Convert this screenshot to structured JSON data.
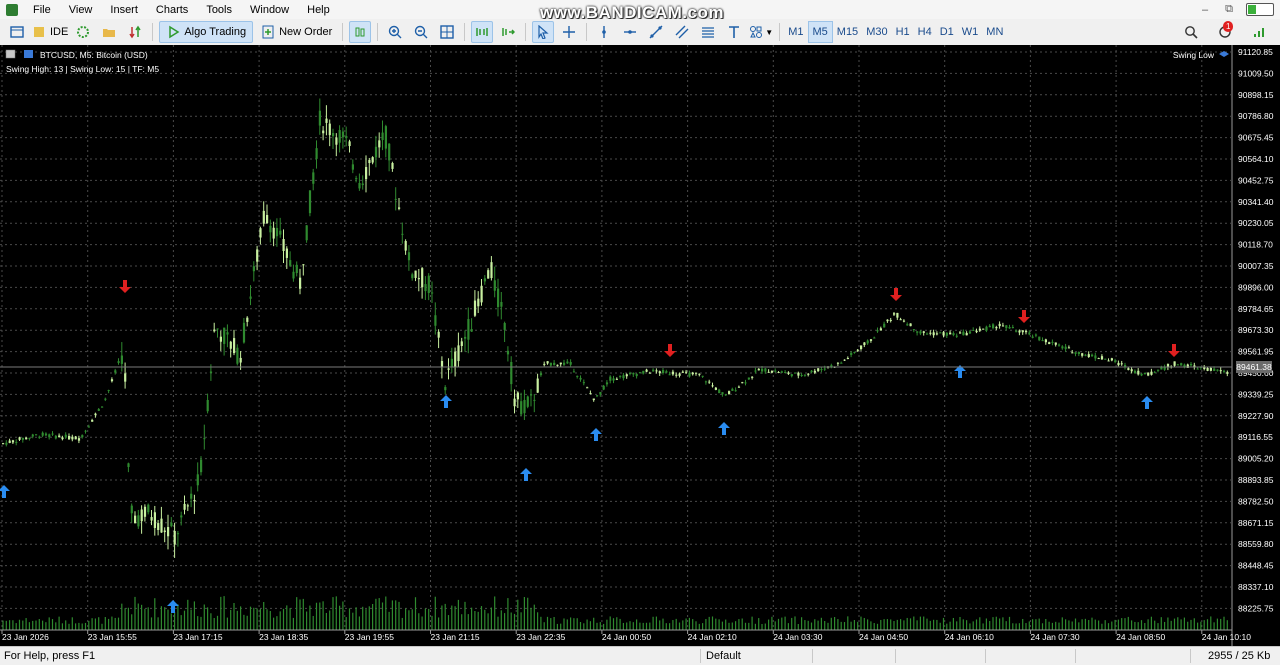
{
  "menu": [
    "File",
    "View",
    "Insert",
    "Charts",
    "Tools",
    "Window",
    "Help"
  ],
  "watermark": "www.BANDICAM.com",
  "toolbar": {
    "ide_label": "IDE",
    "algo_trading_label": "Algo Trading",
    "new_order_label": "New Order",
    "timeframes": [
      "M1",
      "M5",
      "M15",
      "M30",
      "H1",
      "H4",
      "D1",
      "W1",
      "MN"
    ],
    "active_timeframe": "M5",
    "notification_count": "1"
  },
  "chart": {
    "header_symbol": "BTCUSD, M5:  Bitcoin (USD)",
    "indicator_info": "Swing High: 13 | Swing Low: 15 | TF: M5",
    "indicator_name": "Swing Low",
    "current_price_label": "89461.38",
    "price_ticks": [
      "91120.85",
      "91009.50",
      "90898.15",
      "90786.80",
      "90675.45",
      "90564.10",
      "90452.75",
      "90341.40",
      "90230.05",
      "90118.70",
      "90007.35",
      "89896.00",
      "89784.65",
      "89673.30",
      "89561.95",
      "89450.60",
      "89339.25",
      "89227.90",
      "89116.55",
      "89005.20",
      "88893.85",
      "88782.50",
      "88671.15",
      "88559.80",
      "88448.45",
      "88337.10",
      "88225.75"
    ],
    "time_ticks": [
      "23 Jan 2026",
      "23 Jan 15:55",
      "23 Jan 17:15",
      "23 Jan 18:35",
      "23 Jan 19:55",
      "23 Jan 21:15",
      "23 Jan 22:35",
      "24 Jan 00:50",
      "24 Jan 02:10",
      "24 Jan 03:30",
      "24 Jan 04:50",
      "24 Jan 06:10",
      "24 Jan 07:30",
      "24 Jan 08:50",
      "24 Jan 10:10"
    ],
    "colors": {
      "background": "#000000",
      "grid": "#4a4a4a",
      "bull": "#c8f0a0",
      "bear": "#2f8a2f",
      "volume": "#2f8a2f",
      "up_arrow": "#2a8cf0",
      "down_arrow": "#e02020"
    }
  },
  "status_bar": {
    "help": "For Help, press F1",
    "profile": "Default",
    "traffic": "2955 / 25 Kb"
  }
}
